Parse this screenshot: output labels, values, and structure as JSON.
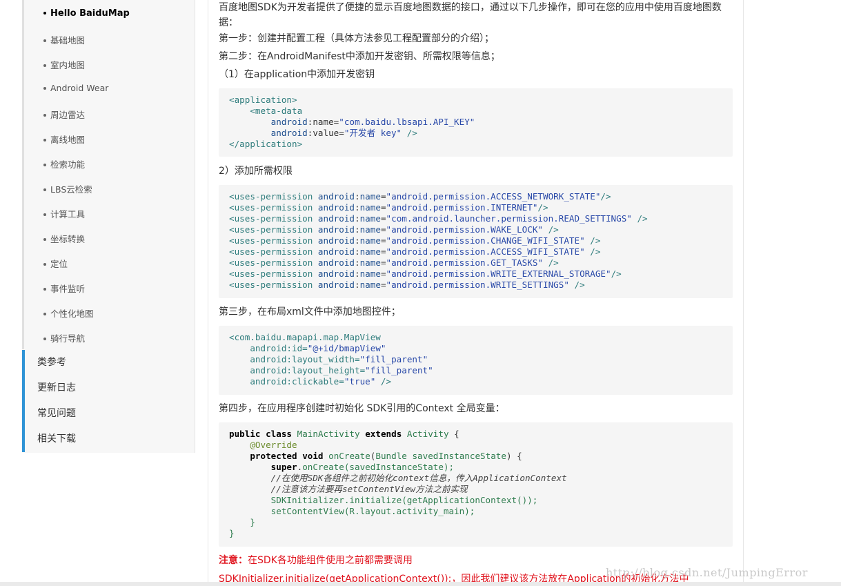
{
  "sidebar": {
    "sub_items": [
      {
        "label": "Hello BaiduMap",
        "active": true
      },
      {
        "label": "基础地图"
      },
      {
        "label": "室内地图"
      },
      {
        "label": "Android Wear"
      },
      {
        "label": "周边雷达"
      },
      {
        "label": "离线地图"
      },
      {
        "label": "检索功能"
      },
      {
        "label": "LBS云检索"
      },
      {
        "label": "计算工具"
      },
      {
        "label": "坐标转换"
      },
      {
        "label": "定位"
      },
      {
        "label": "事件监听"
      },
      {
        "label": "个性化地图"
      },
      {
        "label": "骑行导航"
      }
    ],
    "main_items": [
      "类参考",
      "更新日志",
      "常见问题",
      "相关下载"
    ]
  },
  "content": {
    "intro": "百度地图SDK为开发者提供了便捷的显示百度地图数据的接口，通过以下几步操作，即可在您的应用中使用百度地图数据：",
    "step1": "第一步：创建并配置工程（具体方法参见工程配置部分的介绍）；",
    "step2": "第二步：在AndroidManifest中添加开发密钥、所需权限等信息；",
    "step2_1": "（1）在application中添加开发密钥",
    "step2_2": "2）添加所需权限",
    "step3": "第三步，在布局xml文件中添加地图控件；",
    "step4": "第四步，在应用程序创建时初始化 SDK引用的Context 全局变量：",
    "note_label": "注意：",
    "note_text": "在SDK各功能组件使用之前都需要调用",
    "note_line2": "SDKInitializer.initialize(getApplicationContext());，因此我们建议该方法放在Application的初始化方法中"
  },
  "code": {
    "block1": [
      "<application>",
      "    <meta-data",
      "        android:name=\"com.baidu.lbsapi.API_KEY\"",
      "        android:value=\"开发者 key\" />",
      "</application>"
    ],
    "block2": [
      "android.permission.ACCESS_NETWORK_STATE",
      "android.permission.INTERNET",
      "com.android.launcher.permission.READ_SETTINGS",
      "android.permission.WAKE_LOCK",
      "android.permission.CHANGE_WIFI_STATE",
      "android.permission.ACCESS_WIFI_STATE",
      "android.permission.GET_TASKS",
      "android.permission.WRITE_EXTERNAL_STORAGE",
      "android.permission.WRITE_SETTINGS"
    ],
    "block3": [
      "<com.baidu.mapapi.map.MapView",
      "    android:id=\"@+id/bmapView\"",
      "    android:layout_width=\"fill_parent\"",
      "    android:layout_height=\"fill_parent\"",
      "    android:clickable=\"true\" />"
    ],
    "block4": [
      "public class MainActivity extends Activity {",
      "    @Override",
      "    protected void onCreate(Bundle savedInstanceState) {",
      "        super.onCreate(savedInstanceState);",
      "        //在使用SDK各组件之前初始化context信息，传入ApplicationContext",
      "        //注意该方法要再setContentView方法之前实现",
      "        SDKInitializer.initialize(getApplicationContext());",
      "        setContentView(R.layout.activity_main);",
      "    }",
      "}"
    ]
  },
  "watermark": "http://blog.csdn.net/JumpingError",
  "colors": {
    "accent": "#2e93d6",
    "note_red": "#e0141e",
    "code_bg": "#f5f5f5"
  }
}
